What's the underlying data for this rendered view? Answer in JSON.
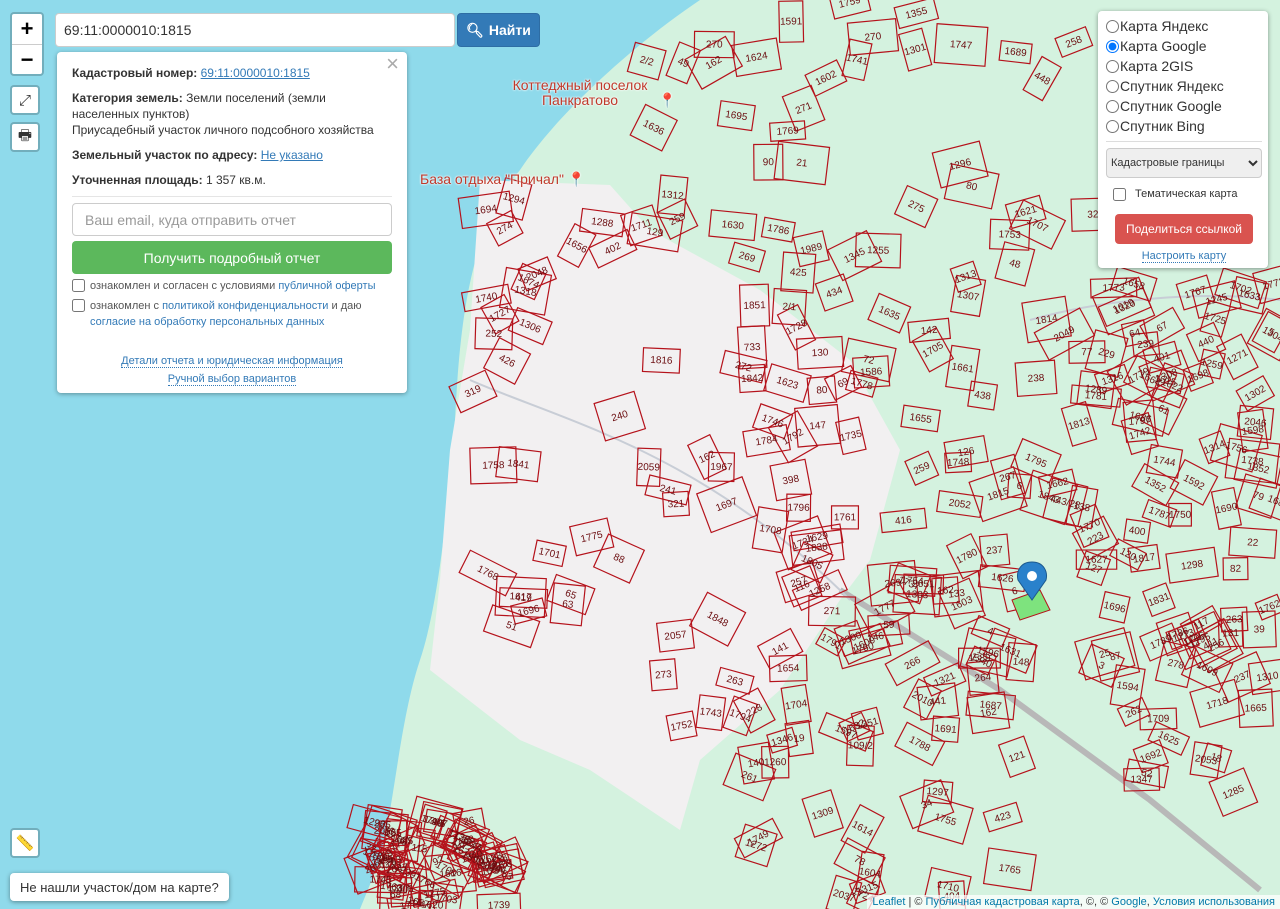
{
  "search": {
    "value": "69:11:0000010:1815",
    "button_label": "Найти"
  },
  "zoom": {
    "in": "+",
    "out": "−"
  },
  "info": {
    "cadastral_label": "Кадастровый номер:",
    "cadastral_value": "69:11:0000010:1815",
    "category_label": "Категория земель:",
    "category_value": "Земли поселений (земли населенных пунктов)",
    "usage": "Приусадебный участок личного подсобного хозяйства",
    "address_label": "Земельный участок по адресу:",
    "address_value": "Не указано",
    "area_label": "Уточненная площадь:",
    "area_value": "1 357 кв.м.",
    "email_placeholder": "Ваш email, куда отправить отчет",
    "report_button": "Получить подробный отчет",
    "consent1_text": "ознакомлен и согласен с условиями ",
    "consent1_link": "публичной оферты",
    "consent2_text": "ознакомлен с ",
    "consent2_link": "политикой конфиденциальности",
    "consent2_mid": " и даю",
    "consent2_link2": "согласие на обработку персональных данных",
    "details_link": "Детали отчета и юридическая информация",
    "manual_link": "Ручной выбор вариантов"
  },
  "layers": {
    "options": [
      "Карта Яндекс",
      "Карта Google",
      "Карта 2GIS",
      "Спутник Яндекс",
      "Спутник Google",
      "Спутник Bing"
    ],
    "selected_index": 1,
    "overlay_select": "Кадастровые границы",
    "thematic_label": "Тематическая карта",
    "share_button": "Поделиться ссылкой",
    "setup_link": "Настроить карту"
  },
  "poi": [
    {
      "name": "Коттеджный поселок Панкратово"
    },
    {
      "name": "База отдыха \"Причал\""
    }
  ],
  "parcels": [
    "321",
    "270",
    "1589",
    "1260",
    "1619",
    "1620",
    "733",
    "269",
    "267",
    "264",
    "263",
    "265",
    "1586",
    "1621",
    "1622",
    "1765",
    "1767",
    "1766",
    "319",
    "320",
    "266",
    "261",
    "262",
    "260",
    "259",
    "271",
    "142",
    "263",
    "278",
    "277",
    "274",
    "275",
    "138",
    "78",
    "79",
    "144",
    "129",
    "130",
    "131",
    "121",
    "120",
    "4",
    "63",
    "80",
    "82",
    "141",
    "3",
    "228",
    "419",
    "90",
    "133",
    "423",
    "87",
    "115",
    "116",
    "126",
    "127",
    "441",
    "229",
    "418",
    "69",
    "21",
    "77",
    "257",
    "117",
    "92",
    "426",
    "448",
    "256",
    "19",
    "52",
    "26",
    "252",
    "258",
    "259",
    "271",
    "39",
    "406",
    "273",
    "272",
    "416",
    "398",
    "223",
    "30",
    "146",
    "147",
    "148",
    "59",
    "67",
    "53",
    "65",
    "49",
    "64",
    "6",
    "440",
    "407",
    "72",
    "2/2",
    "25",
    "140",
    "61",
    "37",
    "2/1",
    "48",
    "411",
    "404",
    "401",
    "105",
    "402",
    "270",
    "269",
    "109/2",
    "400",
    "132",
    "88",
    "80",
    "5",
    "6",
    "18",
    "36",
    "241",
    "162",
    "162",
    "162",
    "239",
    "239",
    "240",
    "162",
    "238",
    "237",
    "237",
    "237",
    "228",
    "425",
    "438",
    "34",
    "22",
    "68",
    "51",
    "434",
    "443/28",
    "1815",
    "1773",
    "1774",
    "1775",
    "1816",
    "1817",
    "1346",
    "1347",
    "1344",
    "1345",
    "1814",
    "1813",
    "1805",
    "1772",
    "1783",
    "1794",
    "1355",
    "1664",
    "1340",
    "1665",
    "1685",
    "1696",
    "1707",
    "1718",
    "1724",
    "1725",
    "1726",
    "1727",
    "1728",
    "1686",
    "1687",
    "1688",
    "1292",
    "1294",
    "1296",
    "1295",
    "1297",
    "1298",
    "1299",
    "1300",
    "1301",
    "1302",
    "1303",
    "1304",
    "1305",
    "1306",
    "1307",
    "1308",
    "1309",
    "1310",
    "1311",
    "1312",
    "1313",
    "1314",
    "1315",
    "1316",
    "1849",
    "1848",
    "1851",
    "1852",
    "1321",
    "1320",
    "1317",
    "1318",
    "1711",
    "1709",
    "1710",
    "1702",
    "1703",
    "1704",
    "1705",
    "1706",
    "1708",
    "1699",
    "1700",
    "1701",
    "1689",
    "1690",
    "1691",
    "1692",
    "1693",
    "1694",
    "1695",
    "1696",
    "1697",
    "1698",
    "1776",
    "1777",
    "1778",
    "1779",
    "1780",
    "1781",
    "1782",
    "1784",
    "1786",
    "1787",
    "1788",
    "1789",
    "1790",
    "1791",
    "1792",
    "1795",
    "1796",
    "1797",
    "1840",
    "1841",
    "1842",
    "1843",
    "1838",
    "1831",
    "1673",
    "1674",
    "1661",
    "1662",
    "1351",
    "1352",
    "1978",
    "1967",
    "1989",
    "2010",
    "2037",
    "2046",
    "2047",
    "2048",
    "2049",
    "2051",
    "2052",
    "2053",
    "2055",
    "2057",
    "2059",
    "1655",
    "1654",
    "1658",
    "1657",
    "1656",
    "1591",
    "1592",
    "1614",
    "1615",
    "1616",
    "1617",
    "1255",
    "1273",
    "1272",
    "1271",
    "1275",
    "1623",
    "1624",
    "1625",
    "1626",
    "1627",
    "1628",
    "1629",
    "1630",
    "1631",
    "1632",
    "1633",
    "1634",
    "1635",
    "1636",
    "1596",
    "1597",
    "1598",
    "1599",
    "1600",
    "1602",
    "1603",
    "1604",
    "1285",
    "1287",
    "1288",
    "1289",
    "1259",
    "1258",
    "1594",
    "1595",
    "1734",
    "1735",
    "1736",
    "1737",
    "1738",
    "1739",
    "1740",
    "1741",
    "1742",
    "1743",
    "1744",
    "1745",
    "1746",
    "1747",
    "1748",
    "1749",
    "1750",
    "1751",
    "1752",
    "1753",
    "1754",
    "1755",
    "1756",
    "1757",
    "1758",
    "1759",
    "1760",
    "1761",
    "1762",
    "1763",
    "1768",
    "1769",
    "1770",
    "4",
    "1245"
  ],
  "ruler_icon": "ruler-icon",
  "not_found_button": "Не нашли участок/дом на карте?",
  "attribution": {
    "leaflet": "Leaflet",
    "sep": " | © ",
    "pkk": "Публичная кадастровая карта",
    "mid": ", ©, © ",
    "google": "Google",
    "comma": ", ",
    "terms": "Условия использования"
  }
}
